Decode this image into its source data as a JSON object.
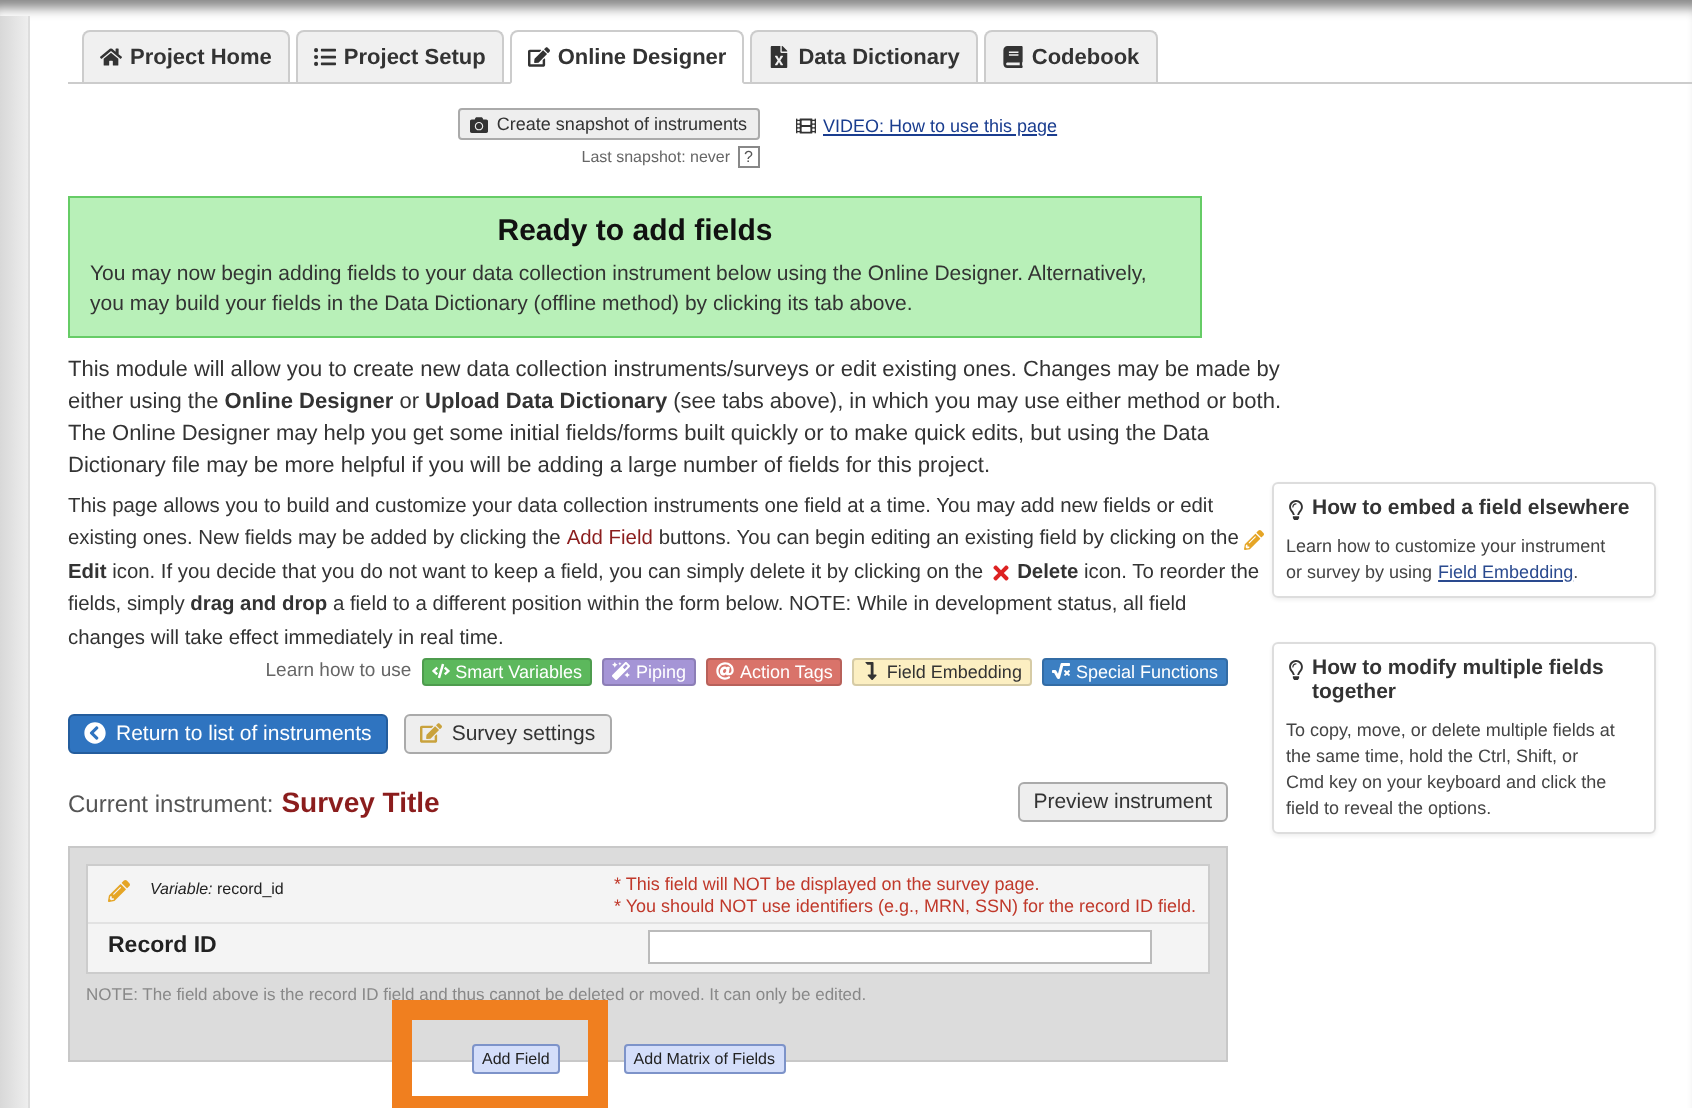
{
  "tabs": [
    {
      "label": "Project Home",
      "selected": false,
      "kind": "home"
    },
    {
      "label": "Project Setup",
      "selected": false,
      "kind": "list"
    },
    {
      "label": "Online Designer",
      "selected": true,
      "kind": "edit"
    },
    {
      "label": "Data Dictionary",
      "selected": false,
      "kind": "sheet"
    },
    {
      "label": "Codebook",
      "selected": false,
      "kind": "book"
    }
  ],
  "snapshot": {
    "button": "Create snapshot of instruments",
    "status": "Last snapshot: never",
    "help": "?"
  },
  "video_link": "VIDEO: How to use this page",
  "notice": {
    "title": "Ready to add fields",
    "text": "You may now begin adding fields to your data collection instrument below using the Online Designer. Alternatively, you may build your fields in the Data Dictionary (offline method) by clicking its tab above."
  },
  "intro": "This module will allow you to create new data collection instruments/surveys or edit existing ones. Changes may be made by either using the **Online Designer** or **Upload Data Dictionary** (see tabs above), in which you may use either method or both. The Online Designer may help you get some initial fields/forms built quickly or to make quick edits, but using the Data Dictionary file may be more helpful if you will be adding a large number of fields for this project.",
  "instructions": [
    [
      {
        "kind": "text",
        "text": "This page allows you to build and customize your data collection instruments one field at a time. You may add new fields or edit"
      }
    ],
    [
      {
        "kind": "text",
        "text": "existing ones. New fields may be added by clicking the"
      },
      {
        "kind": "link",
        "text": "Add Field"
      },
      {
        "kind": "text",
        "text": "buttons. You can begin editing an existing field by clicking on the"
      },
      {
        "kind": "edit_icon"
      }
    ],
    [
      {
        "kind": "text",
        "text": "**Edit** icon. If you decide that you do not want to keep a field, you can simply delete it by clicking on the"
      },
      {
        "kind": "delete_icon"
      },
      {
        "kind": "text",
        "text": "**Delete** icon. To reorder the"
      }
    ],
    [
      {
        "kind": "text",
        "text": "fields, simply **drag and drop** a field to a different position within the form below. NOTE: While in development status, all field"
      }
    ],
    [
      {
        "kind": "text",
        "text": "changes will take effect immediately in real time."
      }
    ]
  ],
  "learn_how": {
    "label": "Learn how to use",
    "badges": [
      {
        "label": "Smart Variables",
        "kind": "smart",
        "color": "#5cb85c"
      },
      {
        "label": "Piping",
        "kind": "piping",
        "color": "#a595d6"
      },
      {
        "label": "Action Tags",
        "kind": "tags",
        "color": "#d9736a"
      },
      {
        "label": "Field Embedding",
        "kind": "embed",
        "color": "#fcefc2"
      },
      {
        "label": "Special Functions",
        "kind": "special",
        "color": "#3c7fc2"
      }
    ]
  },
  "return_button": "Return to list of instruments",
  "survey_settings_button": "Survey settings",
  "instrument": {
    "label": "Current instrument:",
    "title": "Survey Title",
    "preview": "Preview instrument"
  },
  "field": {
    "variable_label": "Variable:",
    "variable": "record_id",
    "warnings": [
      "* This field will NOT be displayed on the survey page.",
      "* You should NOT use identifiers (e.g., MRN, SSN) for the record ID field."
    ],
    "label": "Record ID",
    "note": "NOTE: The field above is the record ID field and thus cannot be deleted or moved. It can only be edited.",
    "add_buttons": [
      "Add Field",
      "Add Matrix of Fields"
    ]
  },
  "tips": [
    {
      "title": "How to embed a field elsewhere",
      "text": [
        [
          {
            "kind": "text",
            "text": "Learn how to customize your instrument"
          }
        ],
        [
          {
            "kind": "text",
            "text": "or survey by using"
          },
          {
            "kind": "link",
            "text": "Field Embedding"
          },
          {
            "kind": "text",
            "text": "."
          }
        ]
      ]
    },
    {
      "title": "How to modify multiple fields together",
      "text": [
        [
          {
            "kind": "text",
            "text": "To copy, move, or delete multiple fields at"
          }
        ],
        [
          {
            "kind": "text",
            "text": "the same time, hold the Ctrl, Shift, or"
          }
        ],
        [
          {
            "kind": "text",
            "text": "Cmd key on your keyboard and click the"
          }
        ],
        [
          {
            "kind": "text",
            "text": "field to reveal the options."
          }
        ]
      ]
    }
  ]
}
